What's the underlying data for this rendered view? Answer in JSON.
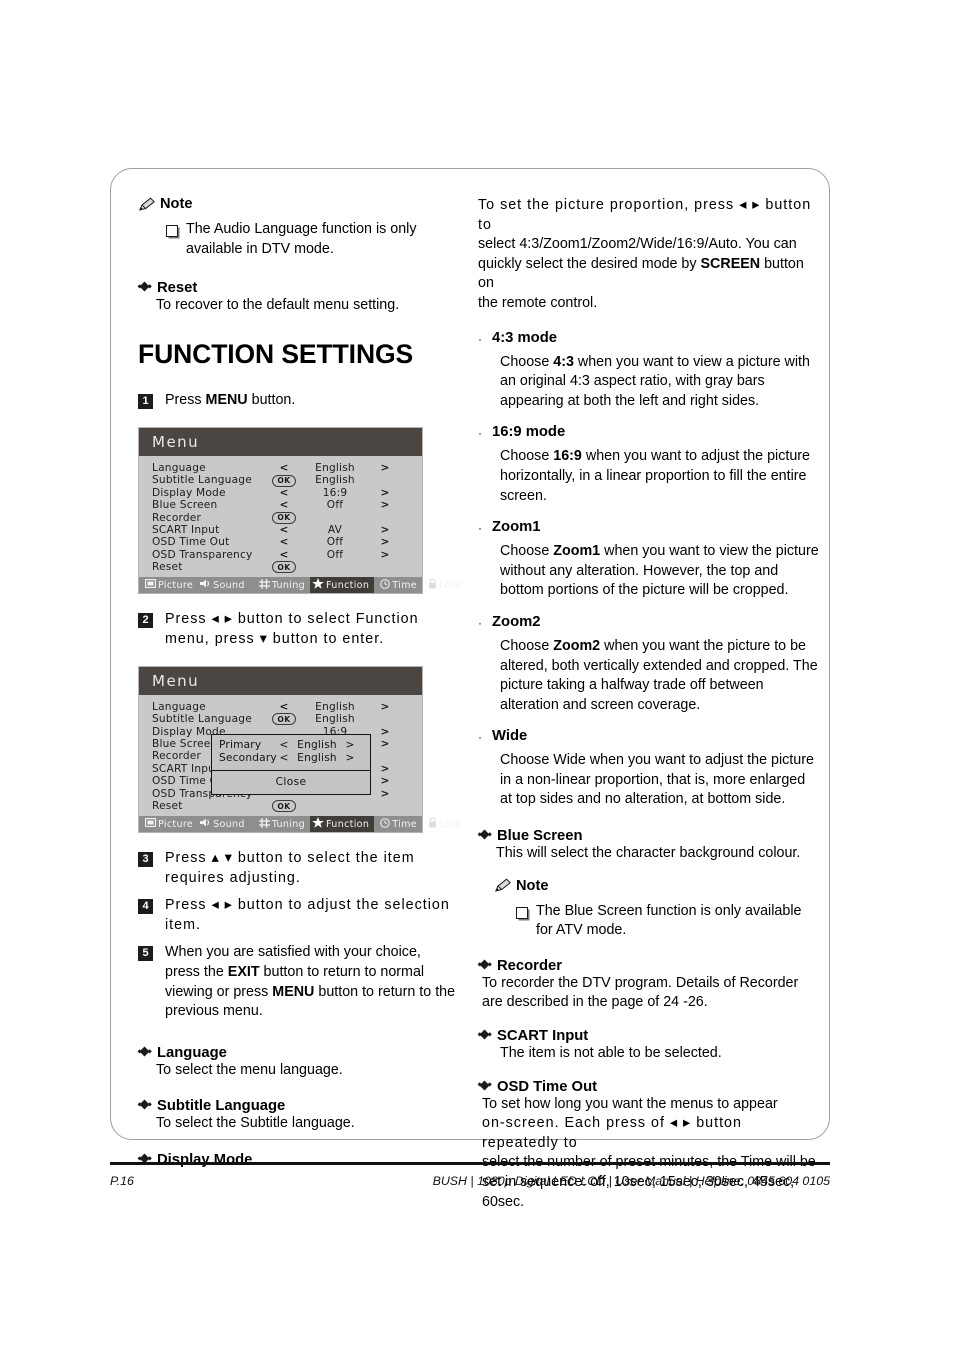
{
  "document": {
    "heading": "FUNCTION SETTINGS"
  },
  "left_column": {
    "note1": {
      "icon": "pencil-icon",
      "title": "Note",
      "items": [
        "The Audio Language function is only available in DTV mode."
      ]
    },
    "reset_section": {
      "title": "Reset",
      "body": "To recover to the default menu setting."
    },
    "steps": [
      {
        "num": "1",
        "text_before": "Press ",
        "bold": "MENU",
        "text_after": " button."
      },
      {
        "num": "2",
        "text": "Press ◂ ▸ button to select Function menu, press ▾ button to enter."
      },
      {
        "num": "3",
        "text": "Press ▴ ▾ button to select the item requires adjusting."
      },
      {
        "num": "4",
        "text": "Press ◂ ▸ button to adjust the selection item."
      },
      {
        "num": "5",
        "text_l1": "When you are satisfied with your choice, press the",
        "b1": "EXIT",
        "t1": " button to return to normal viewing or press",
        "b2": "MENU",
        "t2": " button to return to the previous menu."
      }
    ],
    "sections": [
      {
        "title": "Language",
        "body": "To select the menu language."
      },
      {
        "title": "Subtitle Language",
        "body": "To select the Subtitle language."
      },
      {
        "title": "Display Mode",
        "body": ""
      }
    ]
  },
  "osd_menu_1": {
    "title": "Menu",
    "rows": [
      {
        "label": "Language",
        "left": "<",
        "value": "English",
        "right": ">",
        "control": "arrows"
      },
      {
        "label": "Subtitle Language",
        "left": "OK",
        "value": "English",
        "right": "",
        "control": "ok"
      },
      {
        "label": "Display Mode",
        "left": "<",
        "value": "16:9",
        "right": ">",
        "control": "arrows"
      },
      {
        "label": "Blue Screen",
        "left": "<",
        "value": "Off",
        "right": ">",
        "control": "arrows"
      },
      {
        "label": "Recorder",
        "left": "OK",
        "value": "",
        "right": "",
        "control": "ok"
      },
      {
        "label": "SCART Input",
        "left": "<",
        "value": "AV",
        "right": ">",
        "control": "arrows"
      },
      {
        "label": "OSD Time Out",
        "left": "<",
        "value": "Off",
        "right": ">",
        "control": "arrows"
      },
      {
        "label": "OSD Transparency",
        "left": "<",
        "value": "Off",
        "right": ">",
        "control": "arrows"
      },
      {
        "label": "Reset",
        "left": "OK",
        "value": "",
        "right": "",
        "control": "ok"
      }
    ],
    "tabs": [
      {
        "label": "Picture",
        "icon": "picture-icon",
        "active": false
      },
      {
        "label": "Sound",
        "icon": "speaker-icon",
        "active": false
      },
      {
        "label": "Tuning",
        "icon": "grid-icon",
        "active": false
      },
      {
        "label": "Function",
        "icon": "star-icon",
        "active": true
      },
      {
        "label": "Time",
        "icon": "clock-icon",
        "active": false
      },
      {
        "label": "Lock",
        "icon": "lock-icon",
        "active": false
      }
    ],
    "ok_label": "OK"
  },
  "osd_menu_2": {
    "title": "Menu",
    "rows": [
      {
        "label": "Language",
        "left": "<",
        "value": "English",
        "right": ">",
        "control": "arrows"
      },
      {
        "label": "Subtitle Language",
        "left": "OK",
        "value": "English",
        "right": "",
        "control": "ok"
      },
      {
        "label": "Display Mode",
        "left": "",
        "value": "16:9",
        "right": ">",
        "control": "arrows"
      },
      {
        "label": "Blue Screen",
        "left": "",
        "value": "",
        "right": ">",
        "control": "arrows"
      },
      {
        "label": "Recorder",
        "left": "",
        "value": "",
        "right": "",
        "control": "ok"
      },
      {
        "label": "SCART Input",
        "left": "",
        "value": "",
        "right": ">",
        "control": "arrows"
      },
      {
        "label": "OSD Time Out",
        "left": "",
        "value": "",
        "right": ">",
        "control": "arrows"
      },
      {
        "label": "OSD Transparency",
        "left": "",
        "value": "",
        "right": ">",
        "control": "arrows"
      },
      {
        "label": "Reset",
        "left": "OK",
        "value": "",
        "right": "",
        "control": "ok"
      }
    ],
    "popup": {
      "rows": [
        {
          "label": "Primary",
          "left": "<",
          "value": "English",
          "right": ">"
        },
        {
          "label": "Secondary",
          "left": "<",
          "value": "English",
          "right": ">"
        }
      ],
      "close_label": "Close"
    },
    "tabs": [
      {
        "label": "Picture",
        "icon": "picture-icon",
        "active": false
      },
      {
        "label": "Sound",
        "icon": "speaker-icon",
        "active": false
      },
      {
        "label": "Tuning",
        "icon": "grid-icon",
        "active": false
      },
      {
        "label": "Function",
        "icon": "star-icon",
        "active": true
      },
      {
        "label": "Time",
        "icon": "clock-icon",
        "active": false
      },
      {
        "label": "Lock",
        "icon": "lock-icon",
        "active": false
      }
    ],
    "ok_label": "OK"
  },
  "right_column": {
    "intro": {
      "l1": "To set the picture proportion, press ◂ ▸ button to",
      "l2": "select 4:3/Zoom1/Zoom2/Wide/16:9/Auto. You can",
      "l3_a": "quickly select the desired mode by ",
      "l3_b": "SCREEN",
      "l3_c": " button on",
      "l4": "the remote control."
    },
    "modes": [
      {
        "title": "4:3 mode",
        "body_a": "Choose ",
        "body_b": "4:3",
        "body_c": " when you want to view a picture with an original 4:3 aspect ratio, with gray bars appearing at both the left and right sides."
      },
      {
        "title": "16:9 mode",
        "body_a": "Choose ",
        "body_b": "16:9",
        "body_c": " when you want to adjust the picture horizontally, in a linear proportion to fill the entire screen."
      },
      {
        "title": "Zoom1",
        "body_a": "Choose ",
        "body_b": "Zoom1",
        "body_c": " when you want to view the picture without any alteration. However, the top and bottom portions of the picture will be cropped."
      },
      {
        "title": "Zoom2",
        "body_a": "Choose ",
        "body_b": "Zoom2",
        "body_c": " when you want the picture to be altered, both vertically extended and cropped. The picture taking a halfway trade off between alteration and screen coverage."
      },
      {
        "title": "Wide",
        "body_a": "Choose Wide when you want to adjust the picture in a non-linear proportion, that is, more enlarged at top sides and no alteration, at bottom side.",
        "body_b": "",
        "body_c": ""
      }
    ],
    "blue_screen": {
      "title": "Blue Screen",
      "body": "This will select the character background colour."
    },
    "note2": {
      "icon": "pencil-icon",
      "title": "Note",
      "items": [
        "The Blue Screen function is only available for ATV mode."
      ]
    },
    "recorder": {
      "title": "Recorder",
      "body": "To recorder the DTV program. Details of Recorder are described in the page of 24 -26."
    },
    "scart": {
      "title": "SCART Input",
      "body": "The item is not able to be selected."
    },
    "osd_time_out": {
      "title": "OSD Time Out",
      "l1": "To set how long you want the menus to appear",
      "l2": "on-screen. Each press of ◂ ▸ button repeatedly to",
      "l3": "select the number of preset minutes, the Time will be",
      "l4": "set in sequence: off, 10sec, 15sec, 30sec, 45sec, 60sec."
    }
  },
  "footer": {
    "page": "P.16",
    "info": "BUSH | 1080p  Digital LED LCD | User Manual | Helpline: 0845 604 0105"
  }
}
